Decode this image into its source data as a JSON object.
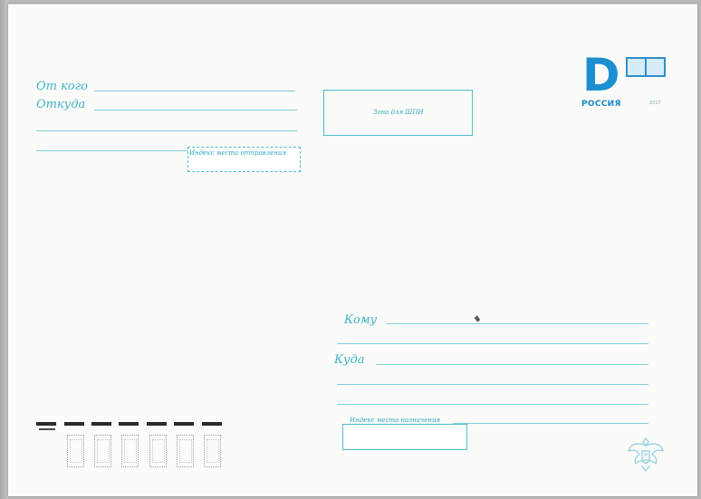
{
  "sender": {
    "from_label": "От кого",
    "where_label": "Откуда",
    "index_label": "Индекс места отправления"
  },
  "ocr_zone": {
    "label": "Зона для ШПИ"
  },
  "stamp": {
    "letter": "D",
    "country": "РОССИЯ",
    "year": "2017"
  },
  "recipient": {
    "to_label": "Кому",
    "where_label": "Куда",
    "index_label": "Индекс места назначения"
  },
  "postal_index": {
    "sample_digits": 7,
    "cells": 6
  },
  "colors": {
    "print_cyan": "#3db3c7",
    "stamp_blue": "#1c8fd0",
    "paper": "#fbfbf9"
  },
  "icons": {
    "stamp": "russian-post-stamp-icon",
    "emblem": "double-headed-eagle-icon"
  }
}
